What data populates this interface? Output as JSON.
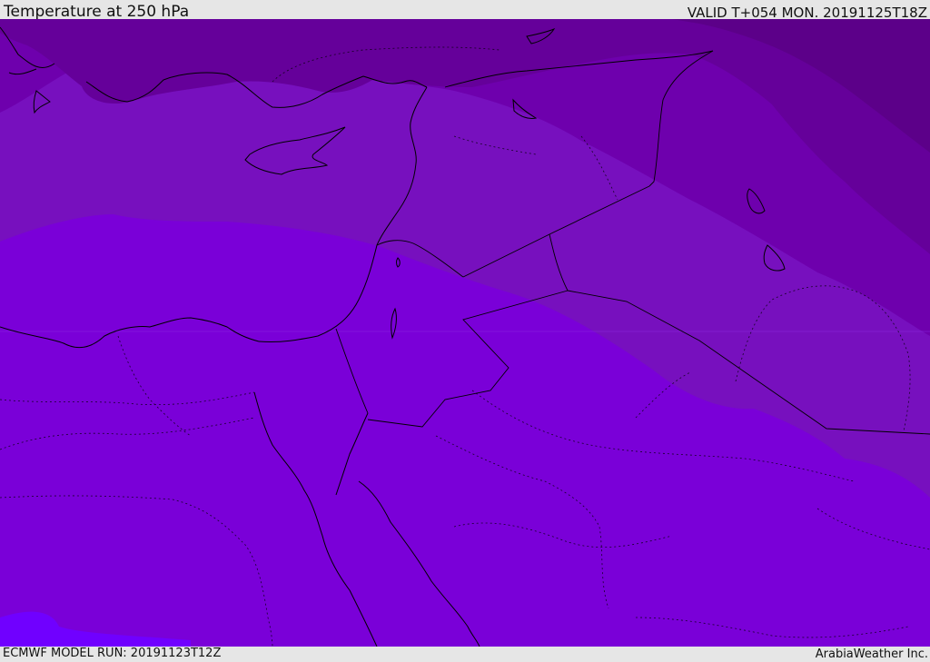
{
  "header": {
    "title": "Temperature at 250 hPa",
    "valid": "VALID T+054 MON. 20191125T18Z"
  },
  "footer": {
    "model_run": "ECMWF MODEL RUN: 20191123T12Z",
    "credit": "ArabiaWeather Inc."
  },
  "map": {
    "field": "Temperature at 250 hPa",
    "shading_colors": [
      "#5c0089",
      "#65009a",
      "#6e00ad",
      "#7710be",
      "#7a00d8",
      "#7000ff"
    ],
    "coastline_color": "#000000",
    "border_style": "dotted"
  }
}
